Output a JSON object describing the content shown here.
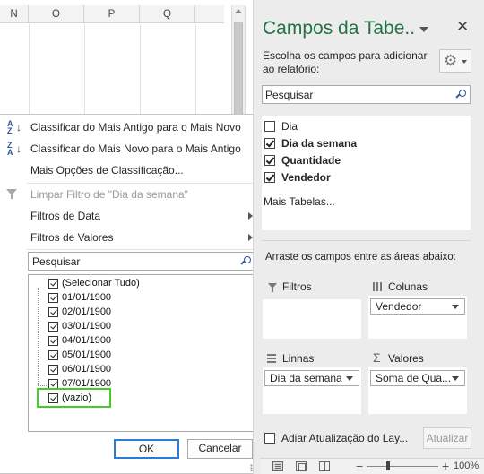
{
  "sheet": {
    "columns": [
      "N",
      "O",
      "P",
      "Q"
    ]
  },
  "filter_menu": {
    "sort_oldest": "Classificar do Mais Antigo para o Mais Novo",
    "sort_newest": "Classificar do Mais Novo para o Mais Antigo",
    "more_sort": "Mais Opções de Classificação...",
    "clear_filter": "Limpar Filtro de \"Dia da semana\"",
    "date_filters": "Filtros de Data",
    "value_filters": "Filtros de Valores",
    "search_placeholder": "Pesquisar",
    "items": [
      "(Selecionar Tudo)",
      "01/01/1900",
      "02/01/1900",
      "03/01/1900",
      "04/01/1900",
      "05/01/1900",
      "06/01/1900",
      "07/01/1900",
      "(vazio)"
    ],
    "ok_label": "OK",
    "cancel_label": "Cancelar"
  },
  "pivot_pane": {
    "title": "Campos da Tabe..",
    "choose_text": "Escolha os campos para adicionar ao relatório:",
    "search_placeholder": "Pesquisar",
    "fields": [
      {
        "label": "Dia",
        "checked": false
      },
      {
        "label": "Dia da semana",
        "checked": true
      },
      {
        "label": "Quantidade",
        "checked": true
      },
      {
        "label": "Vendedor",
        "checked": true
      }
    ],
    "more_tables": "Mais Tabelas...",
    "drag_text": "Arraste os campos entre as áreas abaixo:",
    "areas": {
      "filters": "Filtros",
      "columns": "Colunas",
      "rows": "Linhas",
      "values": "Valores"
    },
    "columns_field": "Vendedor",
    "rows_field": "Dia da semana",
    "values_field": "Soma de Qua...",
    "defer_label": "Adiar Atualização do Lay...",
    "update_label": "Atualizar"
  },
  "status_bar": {
    "zoom": "100%"
  },
  "colors": {
    "accent_green": "#217346",
    "highlight_green": "#44cc22",
    "ok_border_blue": "#2b79d8"
  }
}
